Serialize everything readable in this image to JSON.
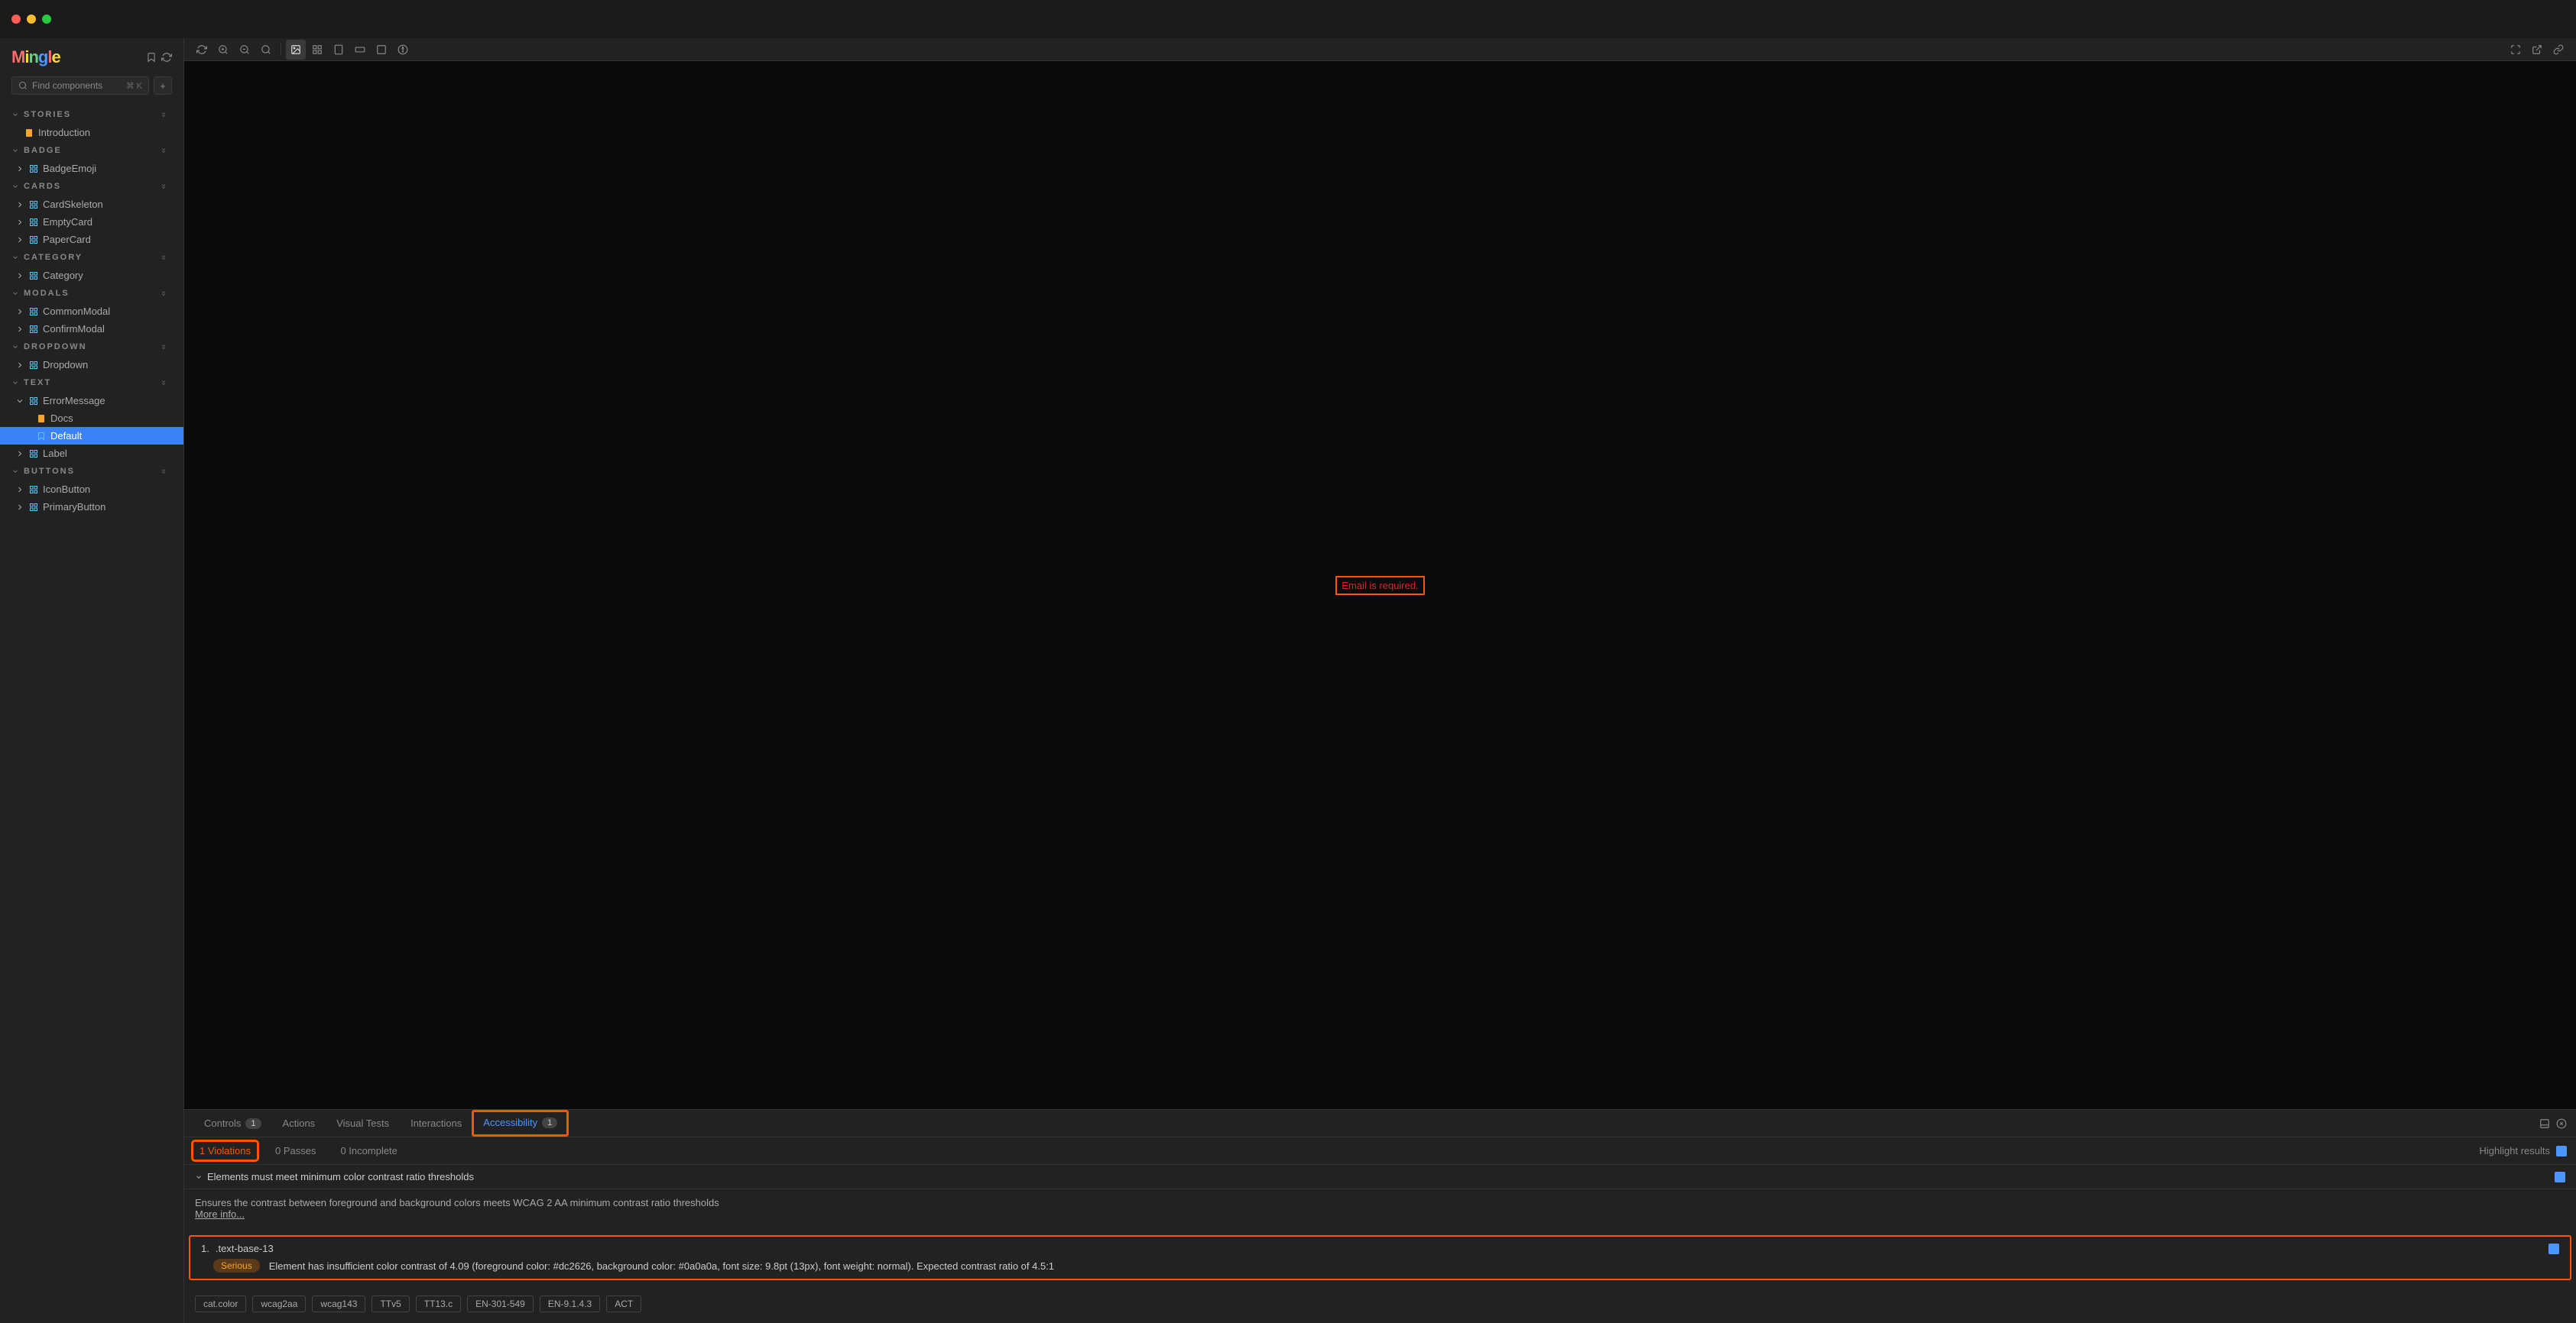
{
  "logo_text": "Mingle",
  "search": {
    "placeholder": "Find components",
    "kbd": "⌘ K"
  },
  "sections": [
    {
      "title": "STORIES",
      "items": [
        {
          "label": "Introduction",
          "type": "doc"
        }
      ]
    },
    {
      "title": "BADGE",
      "items": [
        {
          "label": "BadgeEmoji",
          "type": "comp"
        }
      ]
    },
    {
      "title": "CARDS",
      "items": [
        {
          "label": "CardSkeleton",
          "type": "comp"
        },
        {
          "label": "EmptyCard",
          "type": "comp"
        },
        {
          "label": "PaperCard",
          "type": "comp"
        }
      ]
    },
    {
      "title": "CATEGORY",
      "items": [
        {
          "label": "Category",
          "type": "comp"
        }
      ]
    },
    {
      "title": "MODALS",
      "items": [
        {
          "label": "CommonModal",
          "type": "comp"
        },
        {
          "label": "ConfirmModal",
          "type": "comp"
        }
      ]
    },
    {
      "title": "DROPDOWN",
      "items": [
        {
          "label": "Dropdown",
          "type": "comp"
        }
      ]
    },
    {
      "title": "TEXT",
      "items": [
        {
          "label": "ErrorMessage",
          "type": "comp",
          "expanded": true,
          "children": [
            {
              "label": "Docs",
              "type": "doc"
            },
            {
              "label": "Default",
              "type": "story",
              "selected": true
            }
          ]
        },
        {
          "label": "Label",
          "type": "comp"
        }
      ]
    },
    {
      "title": "BUTTONS",
      "items": [
        {
          "label": "IconButton",
          "type": "comp"
        },
        {
          "label": "PrimaryButton",
          "type": "comp"
        }
      ]
    }
  ],
  "canvas": {
    "error_text": "Email is required."
  },
  "tabs": [
    {
      "label": "Controls",
      "badge": "1"
    },
    {
      "label": "Actions"
    },
    {
      "label": "Visual Tests"
    },
    {
      "label": "Interactions"
    },
    {
      "label": "Accessibility",
      "badge": "1",
      "active": true,
      "highlighted": true
    }
  ],
  "subtabs": [
    {
      "label": "1 Violations",
      "active": true,
      "highlighted": true
    },
    {
      "label": "0 Passes"
    },
    {
      "label": "0 Incomplete"
    }
  ],
  "highlight_label": "Highlight results",
  "violation": {
    "title": "Elements must meet minimum color contrast ratio thresholds",
    "description": "Ensures the contrast between foreground and background colors meets WCAG 2 AA minimum contrast ratio thresholds",
    "more_info": "More info...",
    "item_num": "1.",
    "selector": ".text-base-13",
    "severity_label": "Serious",
    "severity_text": "Element has insufficient color contrast of 4.09 (foreground color: #dc2626, background color: #0a0a0a, font size: 9.8pt (13px), font weight: normal). Expected contrast ratio of 4.5:1",
    "tags": [
      "cat.color",
      "wcag2aa",
      "wcag143",
      "TTv5",
      "TT13.c",
      "EN-301-549",
      "EN-9.1.4.3",
      "ACT"
    ]
  }
}
